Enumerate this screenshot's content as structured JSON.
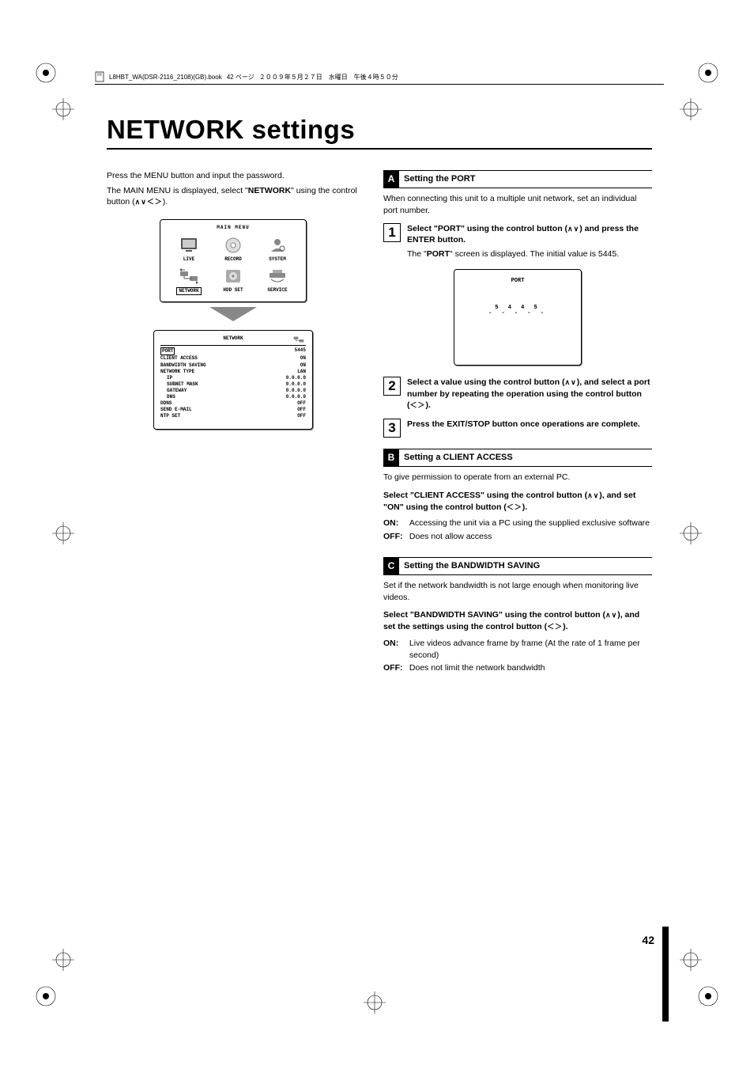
{
  "meta": {
    "filename": "L8HBT_WA(DSR-2116_2108)(GB).book",
    "page_label": "42 ページ",
    "date": "２００９年５月２７日　水曜日　午後４時５０分"
  },
  "title": "NETWORK settings",
  "intro": {
    "line1": "Press the MENU button and input the password.",
    "line2_a": "The MAIN MENU is displayed, select \"",
    "line2_b": "NETWORK",
    "line2_c": "\" using the control button (",
    "line2_d": ")."
  },
  "main_menu": {
    "title": "MAIN MENU",
    "items": [
      {
        "label": "LIVE"
      },
      {
        "label": "RECORD"
      },
      {
        "label": "SYSTEM"
      },
      {
        "label": "NETWORK"
      },
      {
        "label": "HDD SET"
      },
      {
        "label": "SERVICE"
      }
    ]
  },
  "network_menu": {
    "title": "NETWORK",
    "rows": [
      {
        "k": "PORT",
        "v": "5445",
        "selected": true
      },
      {
        "k": "CLIENT ACCESS",
        "v": "ON"
      },
      {
        "k": "BANDWIDTH SAVING",
        "v": "ON"
      },
      {
        "k": "NETWORK TYPE",
        "v": "LAN"
      },
      {
        "k": "IP",
        "v": "0.0.0.0",
        "indent": true
      },
      {
        "k": "SUBNET MASK",
        "v": "0.0.0.0",
        "indent": true
      },
      {
        "k": "GATEWAY",
        "v": "0.0.0.0",
        "indent": true
      },
      {
        "k": "DNS",
        "v": "0.0.0.0",
        "indent": true
      },
      {
        "k": "DDNS",
        "v": "OFF"
      },
      {
        "k": "SEND E-MAIL",
        "v": "OFF"
      },
      {
        "k": "NTP SET",
        "v": "OFF"
      }
    ]
  },
  "section_a": {
    "letter": "A",
    "title": "Setting the PORT",
    "intro": "When connecting this unit to a multiple unit network, set an individual port number.",
    "step1_lead_a": "Select \"PORT\" using the control button (",
    "step1_lead_b": ") and press the ENTER button.",
    "step1_body_a": "The \"",
    "step1_body_b": "PORT",
    "step1_body_c": "\" screen is displayed. The initial value is 5445.",
    "port_panel_title": "PORT",
    "port_value": "5 4 4 5",
    "port_under": "- - - - -",
    "step2_a": "Select a value using the control button (",
    "step2_b": "), and select a port number by repeating the operation using the control button (",
    "step2_c": ").",
    "step3": "Press the EXIT/STOP button once operations are complete."
  },
  "section_b": {
    "letter": "B",
    "title": "Setting a CLIENT ACCESS",
    "intro": "To give permission to operate from an external PC.",
    "inst_a": "Select \"CLIENT ACCESS\" using the control button (",
    "inst_b": "), and set \"ON\" using the control button (",
    "inst_c": ").",
    "on_label": "ON:",
    "on_text": "Accessing the unit via a PC using the supplied exclusive software",
    "off_label": "OFF:",
    "off_text": "Does not allow access"
  },
  "section_c": {
    "letter": "C",
    "title": "Setting the BANDWIDTH SAVING",
    "intro": "Set if the network bandwidth is not large enough when monitoring live videos.",
    "inst_a": "Select \"BANDWIDTH SAVING\" using the control button (",
    "inst_b": "), and set the settings using the control button (",
    "inst_c": ").",
    "on_label": "ON:",
    "on_text": "Live videos advance frame by frame (At the rate of 1 frame per second)",
    "off_label": "OFF:",
    "off_text": "Does not limit the network bandwidth"
  },
  "page_number": "42",
  "glyphs": {
    "updown": "∧∨",
    "leftright": "＜＞",
    "all": "∧∨＜＞"
  }
}
